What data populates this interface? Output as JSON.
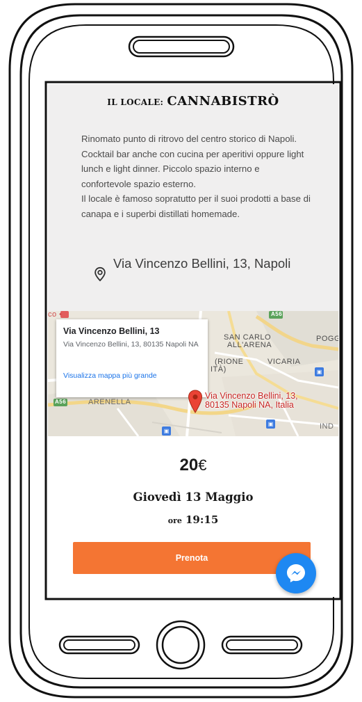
{
  "venue": {
    "prefix": "IL LOCALE:",
    "name": "CANNABISTRÒ"
  },
  "description": {
    "paragraph1": "Rinomato punto di ritrovo del centro storico di Napoli. Cocktail bar anche con cucina per aperitivi oppure light lunch e light dinner. Piccolo spazio interno e confortevole spazio esterno.",
    "paragraph2": "Il locale è famoso sopratutto per il suoi prodotti a base di canapa e i superbi distillati homemade."
  },
  "address": {
    "icon": "location-pin-icon",
    "text": "Via Vincenzo Bellini, 13, Napoli"
  },
  "map": {
    "card_title": "Via Vincenzo Bellini, 13",
    "card_address": "Via Vincenzo Bellini, 13, 80135 Napoli NA",
    "card_link": "Visualizza mappa più grande",
    "marker_label_line1": "Via Vincenzo Bellini, 13,",
    "marker_label_line2": "80135 Napoli NA, Italia",
    "labels": {
      "san_carlo": "SAN CARLO",
      "all_arena": "ALL'ARENA",
      "rione": "(RIONE",
      "ita": "ITÀ)",
      "vicaria": "VICARIA",
      "arenella": "ARENELLA",
      "pogg": "POGG",
      "ind": "IND",
      "road_a56_top": "A56",
      "road_a56_left": "A56",
      "co": "co •"
    }
  },
  "event": {
    "price_value": "20",
    "price_currency": "€",
    "date": "Giovedì 13 Maggio",
    "time_prefix": "ore",
    "time_value": "19:15"
  },
  "actions": {
    "book_label": "Prenota",
    "messenger_icon": "messenger-icon"
  },
  "colors": {
    "accent": "#f47533",
    "messenger": "#1e88f2",
    "map_marker": "#ea4335"
  }
}
